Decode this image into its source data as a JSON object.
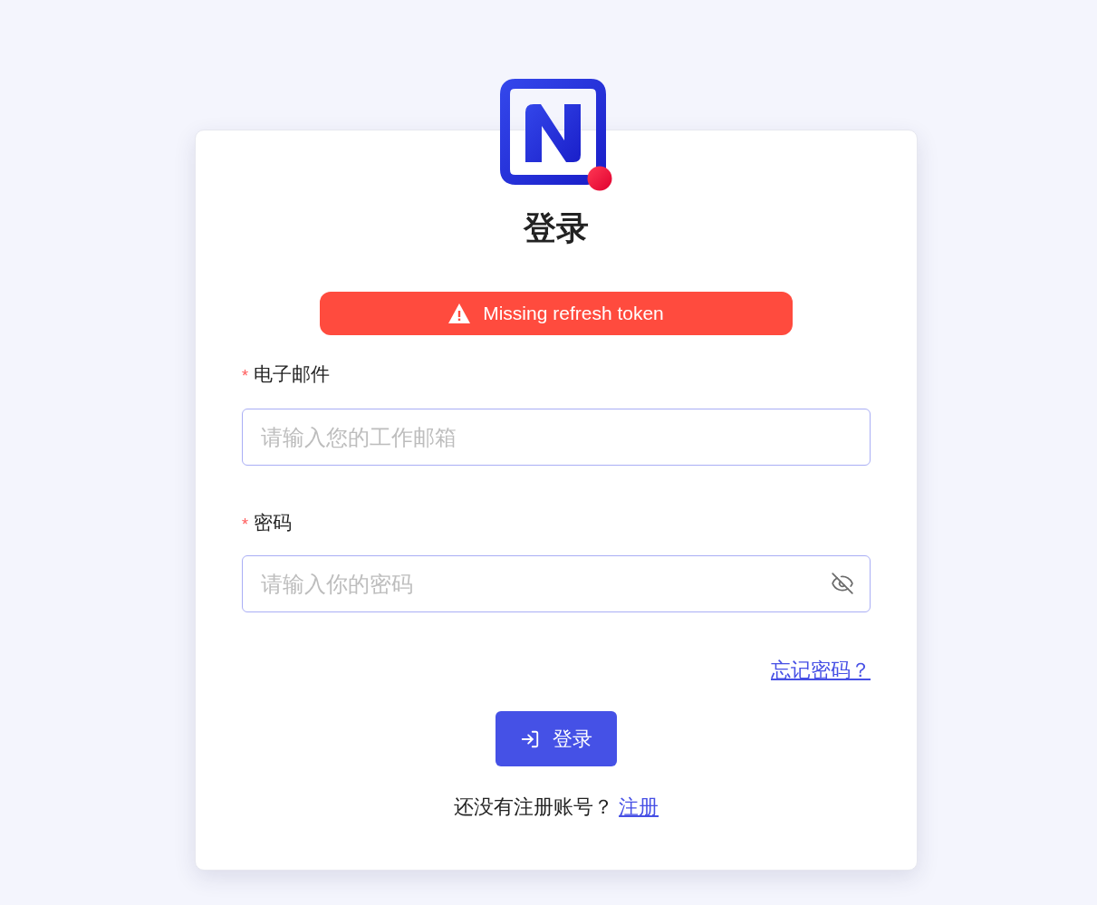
{
  "title": "登录",
  "alert": {
    "kind": "error",
    "message": "Missing refresh token"
  },
  "fields": [
    {
      "kind": "email",
      "marker": "*",
      "label": "电子邮件",
      "placeholder": "请输入您的工作邮箱"
    },
    {
      "kind": "password",
      "marker": "*",
      "label": "密码",
      "placeholder": "请输入你的密码",
      "revealed": false
    }
  ],
  "forgot_link": "忘记密码？",
  "submit_button": "登录",
  "signup": {
    "prompt": "还没有注册账号？",
    "link": "注册"
  }
}
